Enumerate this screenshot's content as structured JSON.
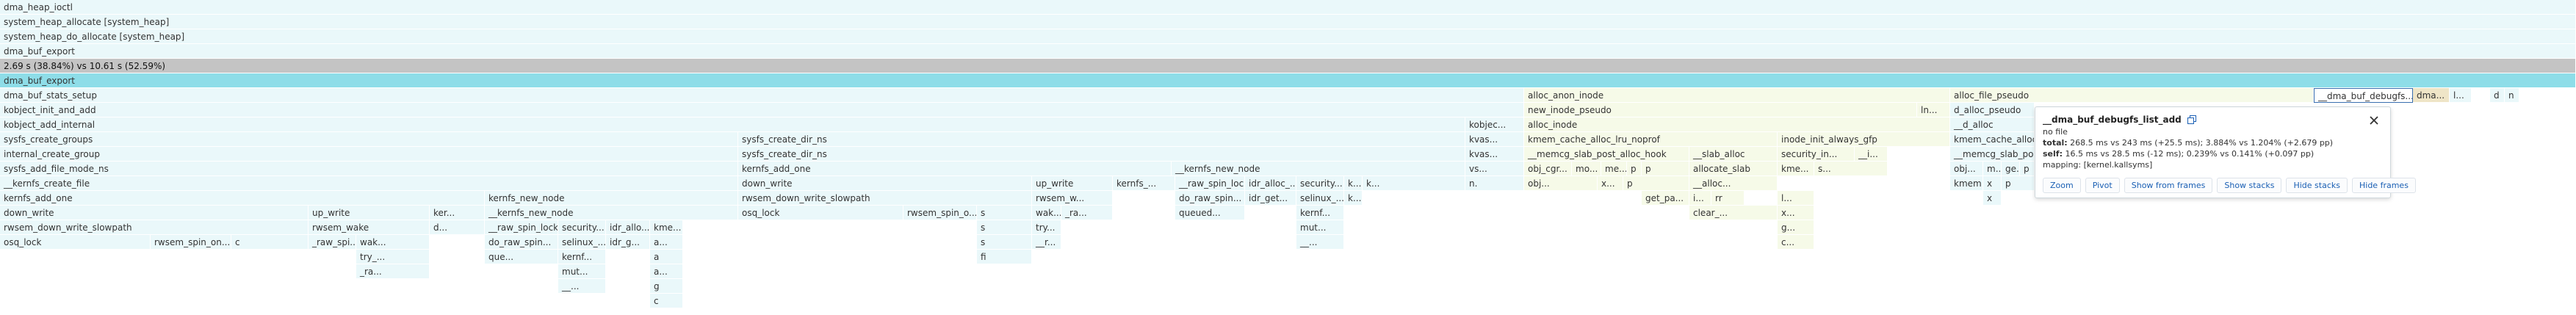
{
  "stack_rows": [
    "dma_heap_ioctl",
    "system_heap_allocate [system_heap]",
    "system_heap_do_allocate [system_heap]",
    "dma_buf_export",
    "2.69 s (38.84%) vs 10.61 s (52.59%)",
    "dma_buf_export"
  ],
  "frames": {
    "r6": [
      "dma_buf_stats_setup",
      "alloc_anon_inode",
      "alloc_file_pseudo",
      "__dma_buf_debugfs...",
      "dma...",
      "l...",
      "d",
      "n"
    ],
    "r7": [
      "kobject_init_and_add",
      "new_inode_pseudo",
      "ln...",
      "d_alloc_pseudo"
    ],
    "r8": [
      "kobject_add_internal",
      "kobjec...",
      "alloc_inode",
      "__d_alloc"
    ],
    "r9": [
      "sysfs_create_groups",
      "sysfs_create_dir_ns",
      "kvas...",
      "kmem_cache_alloc_lru_noprof",
      "inode_init_always_gfp",
      "kmem_cache_alloc"
    ],
    "r10": [
      "internal_create_group",
      "sysfs_create_dir_ns",
      "kvas...",
      "__memcg_slab_post_alloc_hook",
      "__slab_alloc",
      "security_in...",
      "__i...",
      "__memcg_slab_po"
    ],
    "r11": [
      "sysfs_add_file_mode_ns",
      "kernfs_add_one",
      "__kernfs_new_node",
      "vs...",
      "obj_cgr...",
      "mo...",
      "me...",
      "p",
      "p",
      "allocate_slab",
      "kme...",
      "s...",
      "obj...",
      "m...",
      "ge...",
      "p"
    ],
    "r12": [
      "__kernfs_create_file",
      "down_write",
      "up_write",
      "kernfs_...",
      "__raw_spin_lock",
      "idr_alloc_...",
      "security...",
      "k...",
      "k...",
      "n.",
      "obj...",
      "x...",
      "p",
      "__alloc...",
      "kmem...",
      "x",
      "p"
    ],
    "r13": [
      "kernfs_add_one",
      "kernfs_new_node",
      "rwsem_down_write_slowpath",
      "rwsem_w...",
      "do_raw_spin...",
      "idr_get...",
      "selinux_...",
      "k...",
      "get_pa...",
      "i...",
      "rr",
      "l...",
      "x"
    ],
    "r14": [
      "down_write",
      "up_write",
      "ker...",
      "__kernfs_new_node",
      "osq_lock",
      "rwsem_spin_o...",
      "s",
      "wak...",
      "_ra...",
      "queued...",
      "kernf...",
      "clear_...",
      "x..."
    ],
    "r15": [
      "rwsem_down_write_slowpath",
      "rwsem_wake",
      "d...",
      "__raw_spin_lock",
      "security...",
      "idr_allo...",
      "kme...",
      "s",
      "try...",
      "mut...",
      "g..."
    ],
    "r16": [
      "osq_lock",
      "rwsem_spin_on...",
      "c",
      "_raw_spi...",
      "wak...",
      "do_raw_spin...",
      "selinux_...",
      "idr_g...",
      "a...",
      "s",
      "__r...",
      "__...",
      "c..."
    ],
    "r17": [
      "try_...",
      "que...",
      "kernf...",
      "a",
      "fi"
    ],
    "r18": [
      "_ra...",
      "mut...",
      "a..."
    ],
    "r19": [
      "__...",
      "g"
    ],
    "r20": [
      "c"
    ]
  },
  "tooltip": {
    "function": "__dma_buf_debugfs_list_add",
    "file": "no file",
    "total_label": "total:",
    "total_value": "268.5 ms vs 243 ms (+25.5 ms); 3.884% vs 1.204% (+2.679 pp)",
    "self_label": "self:",
    "self_value": "16.5 ms vs 28.5 ms (-12 ms); 0.239% vs 0.141% (+0.097 pp)",
    "mapping": "mapping: [kernel.kallsyms]",
    "actions": [
      "Zoom",
      "Pivot",
      "Show from frames",
      "Show stacks",
      "Hide stacks",
      "Hide frames"
    ]
  },
  "colors": {
    "row_bg": "#eaf8fa",
    "selected_row": "#c4c4c4",
    "highlight_row": "#8edde8",
    "link": "#1a5fb4"
  }
}
